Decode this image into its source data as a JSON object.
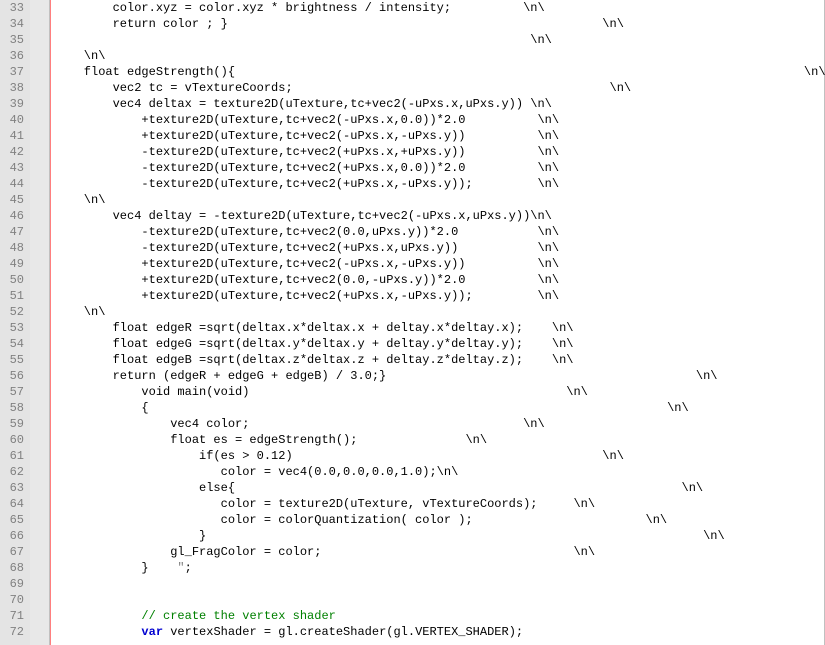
{
  "editor": {
    "first_line_number": 33,
    "lines": [
      {
        "segs": [
          {
            "t": "        color.xyz = color.xyz * brightness / intensity;          \\n\\"
          }
        ]
      },
      {
        "segs": [
          {
            "t": "        return color ; }                                                    \\n\\"
          }
        ]
      },
      {
        "segs": [
          {
            "t": "                                                                  \\n\\"
          }
        ]
      },
      {
        "segs": [
          {
            "t": "    \\n\\"
          }
        ]
      },
      {
        "segs": [
          {
            "t": "    float edgeStrength(){                                                                               \\n\\"
          }
        ]
      },
      {
        "segs": [
          {
            "t": "        vec2 tc = vTextureCoords;                                            \\n\\"
          }
        ]
      },
      {
        "segs": [
          {
            "t": "        vec4 deltax = texture2D(uTexture,tc+vec2(-uPxs.x,uPxs.y)) \\n\\"
          }
        ]
      },
      {
        "segs": [
          {
            "t": "            +texture2D(uTexture,tc+vec2(-uPxs.x,0.0))*2.0          \\n\\"
          }
        ]
      },
      {
        "segs": [
          {
            "t": "            +texture2D(uTexture,tc+vec2(-uPxs.x,-uPxs.y))          \\n\\"
          }
        ]
      },
      {
        "segs": [
          {
            "t": "            -texture2D(uTexture,tc+vec2(+uPxs.x,+uPxs.y))          \\n\\"
          }
        ]
      },
      {
        "segs": [
          {
            "t": "            -texture2D(uTexture,tc+vec2(+uPxs.x,0.0))*2.0          \\n\\"
          }
        ]
      },
      {
        "segs": [
          {
            "t": "            -texture2D(uTexture,tc+vec2(+uPxs.x,-uPxs.y));         \\n\\"
          }
        ]
      },
      {
        "segs": [
          {
            "t": "    \\n\\"
          }
        ]
      },
      {
        "segs": [
          {
            "t": "        vec4 deltay = -texture2D(uTexture,tc+vec2(-uPxs.x,uPxs.y))\\n\\"
          }
        ]
      },
      {
        "segs": [
          {
            "t": "            -texture2D(uTexture,tc+vec2(0.0,uPxs.y))*2.0           \\n\\"
          }
        ]
      },
      {
        "segs": [
          {
            "t": "            -texture2D(uTexture,tc+vec2(+uPxs.x,uPxs.y))           \\n\\"
          }
        ]
      },
      {
        "segs": [
          {
            "t": "            +texture2D(uTexture,tc+vec2(-uPxs.x,-uPxs.y))          \\n\\"
          }
        ]
      },
      {
        "segs": [
          {
            "t": "            +texture2D(uTexture,tc+vec2(0.0,-uPxs.y))*2.0          \\n\\"
          }
        ]
      },
      {
        "segs": [
          {
            "t": "            +texture2D(uTexture,tc+vec2(+uPxs.x,-uPxs.y));         \\n\\"
          }
        ]
      },
      {
        "segs": [
          {
            "t": "    \\n\\"
          }
        ]
      },
      {
        "segs": [
          {
            "t": "        float edgeR =sqrt(deltax.x*deltax.x + deltay.x*deltay.x);    \\n\\"
          }
        ]
      },
      {
        "segs": [
          {
            "t": "        float edgeG =sqrt(deltax.y*deltax.y + deltay.y*deltay.y);    \\n\\"
          }
        ]
      },
      {
        "segs": [
          {
            "t": "        float edgeB =sqrt(deltax.z*deltax.z + deltay.z*deltay.z);    \\n\\"
          }
        ]
      },
      {
        "segs": [
          {
            "t": "        return (edgeR + edgeG + edgeB) / 3.0;}                                           \\n\\"
          }
        ]
      },
      {
        "segs": [
          {
            "t": "            void main(void)                                            \\n\\"
          }
        ]
      },
      {
        "segs": [
          {
            "t": "            {                                                                        \\n\\"
          }
        ]
      },
      {
        "segs": [
          {
            "t": "                vec4 color;                                      \\n\\"
          }
        ]
      },
      {
        "segs": [
          {
            "t": "                float es = edgeStrength();               \\n\\"
          }
        ]
      },
      {
        "segs": [
          {
            "t": "                    if(es > 0.12)                                           \\n\\"
          }
        ]
      },
      {
        "segs": [
          {
            "t": "                       color = vec4(0.0,0.0,0.0,1.0);\\n\\"
          }
        ]
      },
      {
        "segs": [
          {
            "t": "                    else{                                                              \\n\\"
          }
        ]
      },
      {
        "segs": [
          {
            "t": "                       color = texture2D(uTexture, vTextureCoords);     \\n\\"
          }
        ]
      },
      {
        "segs": [
          {
            "t": "                       color = colorQuantization( color );                        \\n\\"
          }
        ]
      },
      {
        "segs": [
          {
            "t": "                    }                                                                     \\n\\"
          }
        ]
      },
      {
        "segs": [
          {
            "t": "                gl_FragColor = color;                                   \\n\\"
          }
        ]
      },
      {
        "segs": [
          {
            "t": "            }    "
          },
          {
            "t": "\"",
            "cls": "string"
          },
          {
            "t": ";"
          }
        ]
      },
      {
        "segs": [
          {
            "t": ""
          }
        ]
      },
      {
        "segs": [
          {
            "t": ""
          }
        ]
      },
      {
        "segs": [
          {
            "t": "            "
          },
          {
            "t": "// create the vertex shader",
            "cls": "comment"
          }
        ]
      },
      {
        "segs": [
          {
            "t": "            "
          },
          {
            "t": "var",
            "cls": "kw"
          },
          {
            "t": " vertexShader = gl.createShader(gl.VERTEX_SHADER);"
          }
        ]
      }
    ]
  }
}
